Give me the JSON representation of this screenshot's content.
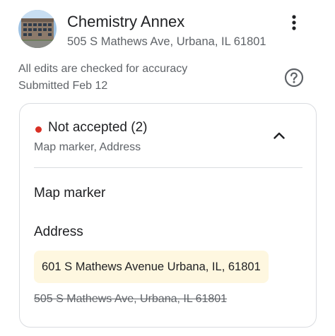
{
  "place": {
    "name": "Chemistry Annex",
    "address": "505 S Mathews Ave, Urbana, IL 61801"
  },
  "info": {
    "accuracy_note": "All edits are checked for accuracy",
    "submitted": "Submitted Feb 12"
  },
  "icons": {
    "more": "more-vert-icon",
    "help": "help-icon",
    "collapse": "chevron-up-icon",
    "status": "status-dot"
  },
  "edit_card": {
    "status_title": "Not accepted (2)",
    "status_summary": "Map marker, Address",
    "status_color": "#d93025",
    "fields": [
      {
        "label": "Map marker"
      },
      {
        "label": "Address",
        "suggested_value": "601 S Mathews Avenue Urbana, IL, 61801",
        "original_value": "505 S Mathews Ave, Urbana, IL 61801"
      }
    ]
  },
  "colors": {
    "suggested_bg": "#fef7e0",
    "border": "#dadce0",
    "text_secondary": "#5f6368"
  }
}
